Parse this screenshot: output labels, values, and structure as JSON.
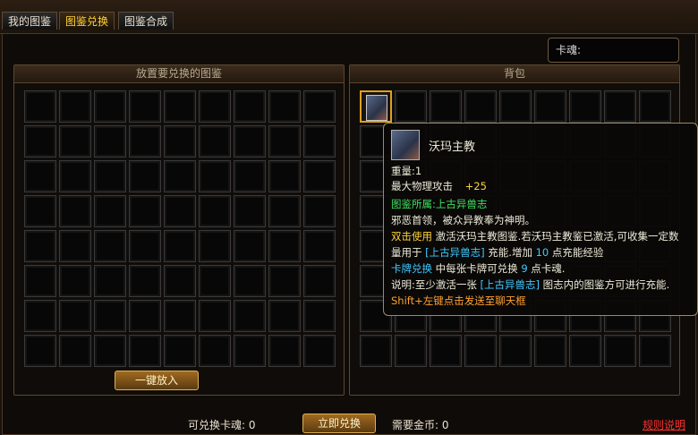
{
  "tabs": [
    {
      "label": "我的图鉴",
      "active": false
    },
    {
      "label": "图鉴兑换",
      "active": true
    },
    {
      "label": "图鉴合成",
      "active": false
    }
  ],
  "soul_label": "卡魂:",
  "left_panel": {
    "title": "放置要兑换的图鉴",
    "button": "一键放入"
  },
  "right_panel": {
    "title": "背包"
  },
  "bottom": {
    "exchangeable_label": "可兑换卡魂:",
    "exchangeable_value": "0",
    "exchange_button": "立即兑换",
    "gold_label": "需要金币:",
    "gold_value": "0",
    "rules_link": "规则说明"
  },
  "tooltip": {
    "name": "沃玛主教",
    "weight": "重量:1",
    "attack_label": "最大物理攻击",
    "attack_value": "+25",
    "belongs": "图鉴所属:上古异兽志",
    "desc": "邪恶首领，被众异教奉为神明。",
    "use_line1_a": "双击使用",
    "use_line1_b": " 激活沃玛主教图鉴.若沃玛主教鉴已激活,可收集一定数",
    "use_line2_a": "量用于",
    "use_line2_b": "[上古异兽志]",
    "use_line2_c": "充能.增加",
    "use_line2_d": "10",
    "use_line2_e": "点充能经验",
    "card_a": "卡牌兑换",
    "card_b": " 中每张卡牌可兑换",
    "card_c": "9",
    "card_d": "点卡魂.",
    "note_a": "说明:至少激活一张",
    "note_b": "[上古异兽志]",
    "note_c": "图志内的图鉴方可进行充能.",
    "shift_hint": "Shift+左键点击发送至聊天框"
  }
}
